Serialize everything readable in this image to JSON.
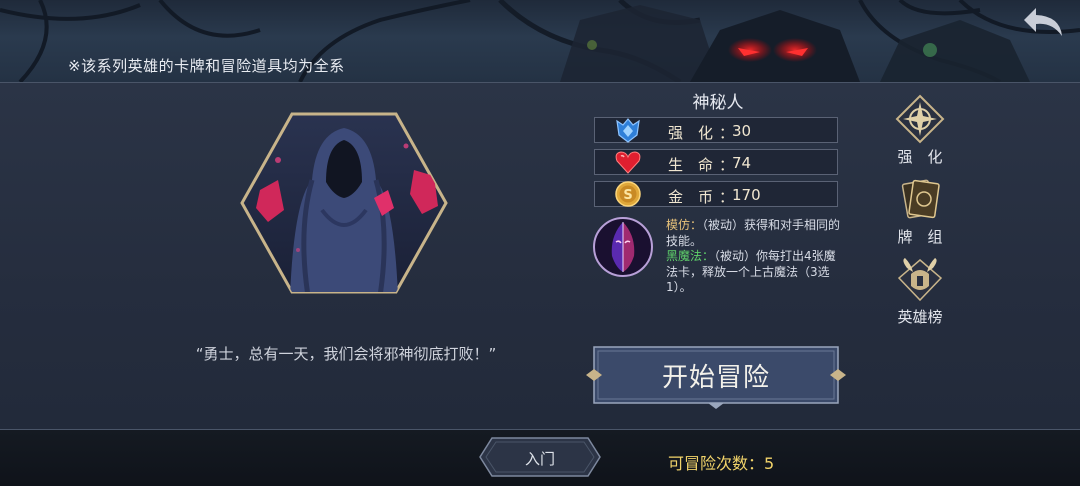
{
  "header": {
    "notice": "※该系列英雄的卡牌和冒险道具均为全系"
  },
  "hero": {
    "name": "神秘人",
    "quote": "“勇士，总有一天，我们会将邪神彻底打败！”",
    "stats": [
      {
        "icon": "shield-gem-icon",
        "label": "强　化",
        "value": "30"
      },
      {
        "icon": "heart-icon",
        "label": "生　命",
        "value": "74"
      },
      {
        "icon": "gold-coin-icon",
        "label": "金　币",
        "value": "170"
      }
    ],
    "skills": [
      {
        "name": "模仿：",
        "desc": "（被动）获得和对手相同的技能。"
      },
      {
        "name": "黑魔法：",
        "desc": "（被动）你每打出4张魔法卡，释放一个上古魔法（3选1）。"
      }
    ]
  },
  "actions": {
    "start": "开始冒险",
    "upgrade": "强　化",
    "deck": "牌　组",
    "leaderboard": "英雄榜"
  },
  "footer": {
    "beginner": "入门",
    "attempts_label": "可冒险次数：",
    "attempts_value": "5"
  },
  "colors": {
    "accent_gold": "#e8c27a",
    "skill_green": "#5fd06a",
    "attempts_yellow": "#f2d46a"
  }
}
